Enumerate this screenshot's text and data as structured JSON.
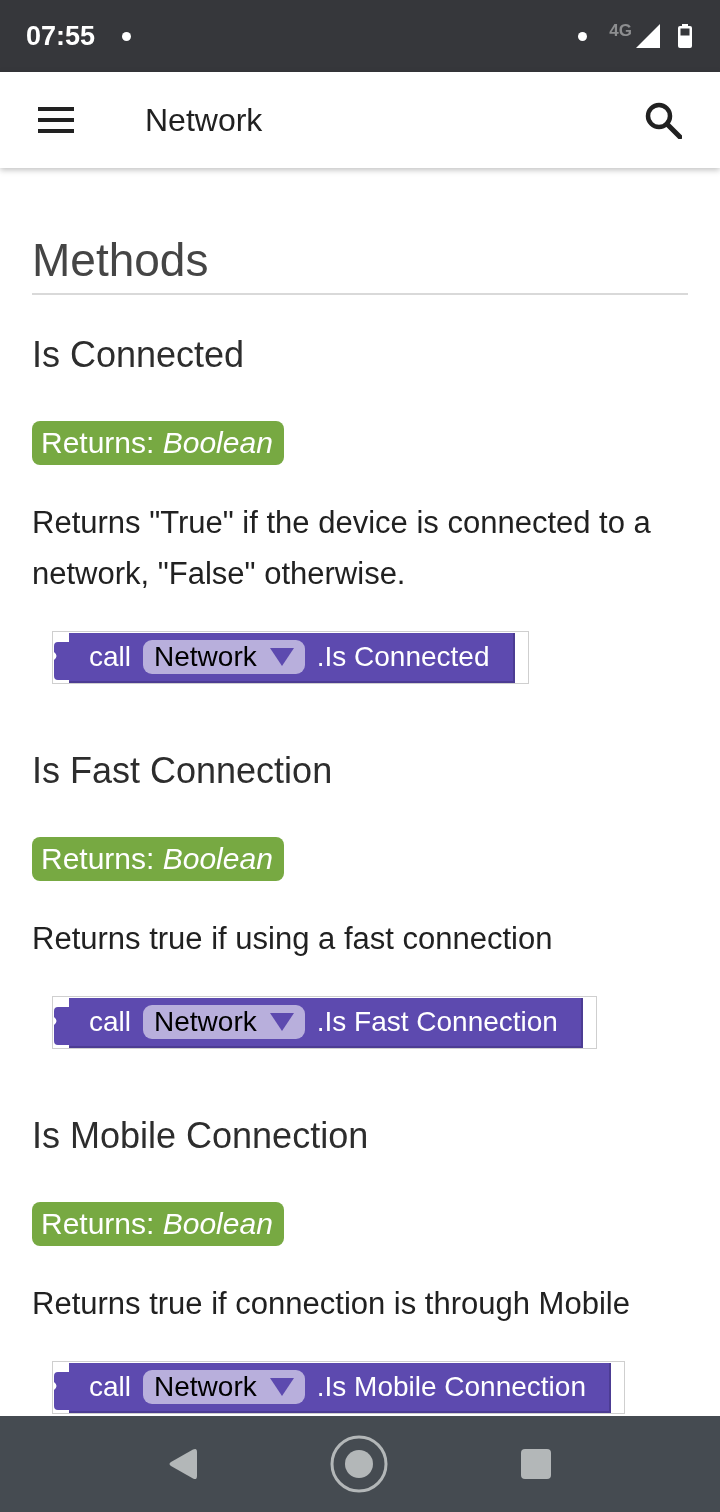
{
  "status_bar": {
    "time": "07:55",
    "network_type": "4G"
  },
  "app_bar": {
    "title": "Network"
  },
  "section": {
    "title": "Methods"
  },
  "methods": [
    {
      "name": "Is Connected",
      "returns": "Returns: *Boolean*",
      "description": "Returns \"True\" if the device is connected to a network, \"False\" otherwise.",
      "block": {
        "keyword": "call",
        "component": "Network",
        "method": ".Is Connected"
      }
    },
    {
      "name": "Is Fast Connection",
      "returns": "Returns: *Boolean*",
      "description": "Returns true if using a fast connection",
      "block": {
        "keyword": "call",
        "component": "Network",
        "method": ".Is Fast Connection"
      }
    },
    {
      "name": "Is Mobile Connection",
      "returns": "Returns: *Boolean*",
      "description": "Returns true if connection is through Mobile",
      "block": {
        "keyword": "call",
        "component": "Network",
        "method": ".Is Mobile Connection"
      }
    }
  ]
}
